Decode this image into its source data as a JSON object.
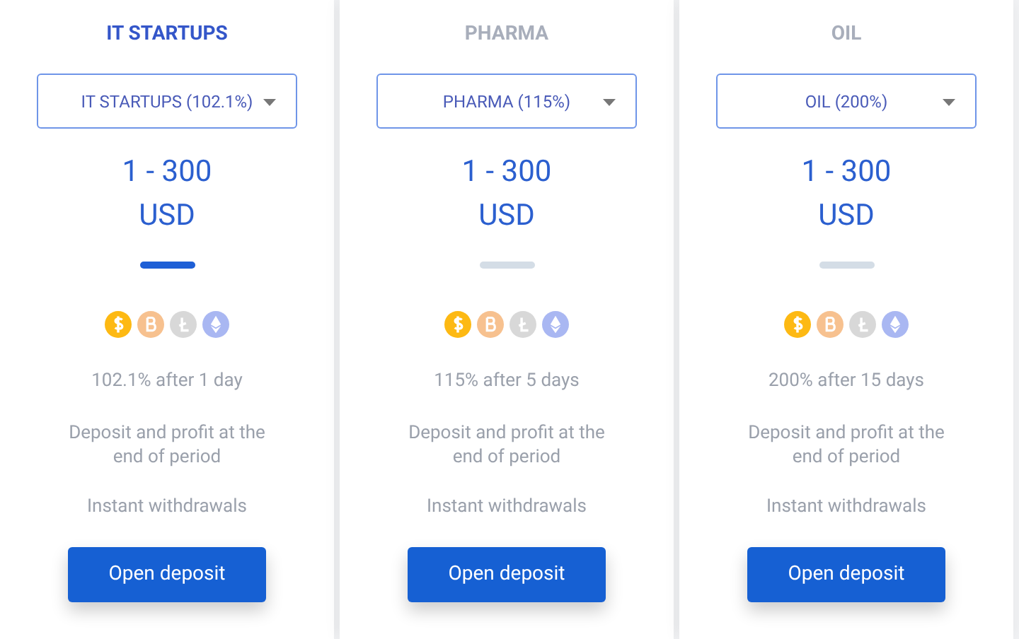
{
  "plans": [
    {
      "title": "IT STARTUPS",
      "selected": true,
      "dropdown": "IT STARTUPS (102.1%)",
      "range": "1 - 300",
      "currency": "USD",
      "return": "102.1% after 1 day",
      "terms": "Deposit and profit at the end of period",
      "withdrawals": "Instant withdrawals",
      "button": "Open deposit"
    },
    {
      "title": "PHARMA",
      "selected": false,
      "dropdown": "PHARMA (115%)",
      "range": "1 - 300",
      "currency": "USD",
      "return": "115% after 5 days",
      "terms": "Deposit and profit at the end of period",
      "withdrawals": "Instant withdrawals",
      "button": "Open deposit"
    },
    {
      "title": "OIL",
      "selected": false,
      "dropdown": "OIL (200%)",
      "range": "1 - 300",
      "currency": "USD",
      "return": "200% after 15 days",
      "terms": "Deposit and profit at the end of period",
      "withdrawals": "Instant withdrawals",
      "button": "Open deposit"
    }
  ]
}
